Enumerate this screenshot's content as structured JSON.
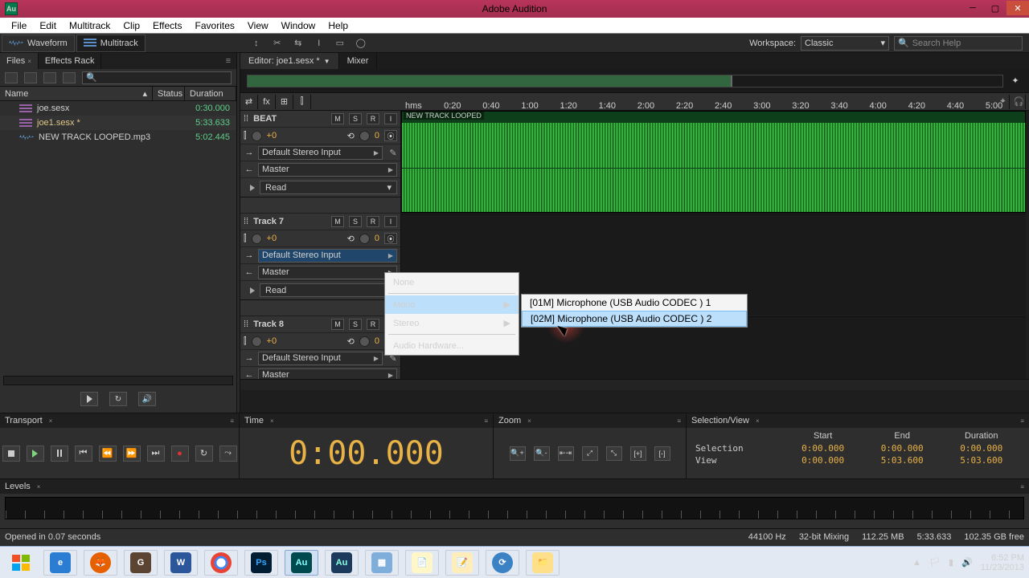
{
  "titlebar": {
    "app_title": "Adobe Audition"
  },
  "menubar": [
    "File",
    "Edit",
    "Multitrack",
    "Clip",
    "Effects",
    "Favorites",
    "View",
    "Window",
    "Help"
  ],
  "workspace": {
    "tab_waveform": "Waveform",
    "tab_multitrack": "Multitrack",
    "label": "Workspace:",
    "preset": "Classic",
    "search_placeholder": "Search Help"
  },
  "files_panel": {
    "tab_files": "Files",
    "tab_fx": "Effects Rack",
    "col_name": "Name",
    "col_status": "Status",
    "col_duration": "Duration",
    "rows": [
      {
        "name": "joe.sesx",
        "dur": "0:30.000"
      },
      {
        "name": "joe1.sesx *",
        "dur": "5:33.633"
      },
      {
        "name": "NEW TRACK  LOOPED.mp3",
        "dur": "5:02.445"
      }
    ]
  },
  "editor": {
    "tab_label": "Editor: joe1.sesx *",
    "tab_mixer": "Mixer",
    "ruler": [
      "hms",
      "0:20",
      "0:40",
      "1:00",
      "1:20",
      "1:40",
      "2:00",
      "2:20",
      "2:40",
      "3:00",
      "3:20",
      "3:40",
      "4:00",
      "4:20",
      "4:40",
      "5:00"
    ]
  },
  "tracks": [
    {
      "name": "BEAT",
      "gain": "+0",
      "pan": "0",
      "input": "Default Stereo Input",
      "output": "Master",
      "auto": "Read",
      "clip": "NEW TRACK  LOOPED"
    },
    {
      "name": "Track 7",
      "gain": "+0",
      "pan": "0",
      "input": "Default Stereo Input",
      "output": "Master",
      "auto": "Read"
    },
    {
      "name": "Track 8",
      "gain": "+0",
      "pan": "0",
      "input": "Default Stereo Input",
      "output": "Master"
    }
  ],
  "ctx1": {
    "none": "None",
    "mono": "Mono",
    "stereo": "Stereo",
    "hw": "Audio Hardware..."
  },
  "ctx2": {
    "opt1": "[01M] Microphone (USB Audio CODEC ) 1",
    "opt2": "[02M] Microphone (USB Audio CODEC ) 2"
  },
  "transport_label": "Transport",
  "time_label": "Time",
  "time_display": "0:00.000",
  "zoom_label": "Zoom",
  "selview": {
    "title": "Selection/View",
    "cols": [
      "Start",
      "End",
      "Duration"
    ],
    "rows": [
      {
        "lbl": "Selection",
        "start": "0:00.000",
        "end": "0:00.000",
        "dur": "0:00.000"
      },
      {
        "lbl": "View",
        "start": "0:00.000",
        "end": "5:03.600",
        "dur": "5:03.600"
      }
    ]
  },
  "levels_label": "Levels",
  "status": {
    "left": "Opened in 0.07 seconds",
    "sr": "44100 Hz",
    "bit": "32-bit Mixing",
    "size": "112.25 MB",
    "dur": "5:33.633",
    "free": "102.35 GB free"
  },
  "tray": {
    "time": "6:52 PM",
    "date": "11/23/2013"
  },
  "msr": {
    "m": "M",
    "s": "S",
    "r": "R"
  }
}
